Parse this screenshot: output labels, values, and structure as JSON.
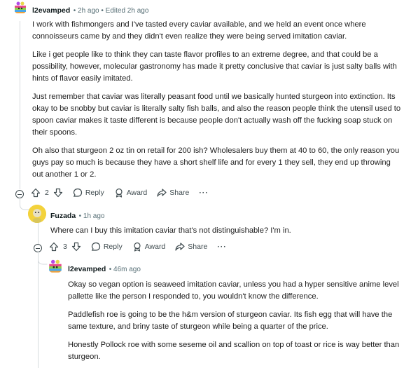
{
  "comment1": {
    "username": "l2evamped",
    "meta": "• 2h ago • Edited 2h ago",
    "paragraphs": [
      "I work with fishmongers and I've tasted every caviar available, and we held an event once where connoisseurs came by and they didn't even realize they were being served imitation caviar.",
      "Like i get people like to think they can taste flavor profiles to an extreme degree, and that could be a possibility, however, molecular gastronomy has made it pretty conclusive that caviar is just salty balls with hints of flavor easily imitated.",
      "Just remember that caviar was literally peasant food until we basically hunted sturgeon into extinction. Its okay to be snobby but caviar is literally salty fish balls, and also the reason people think the utensil used to spoon caviar makes it taste different is because people don't actually wash off the fucking soap stuck on their spoons.",
      "Oh also that sturgeon 2 oz tin on retail for 200 ish? Wholesalers buy them at 40 to 60, the only reason you guys pay so much is because they have a short shelf life and for every 1 they sell, they end up throwing out another 1 or 2."
    ],
    "votes": "2",
    "reply_label": "Reply",
    "award_label": "Award",
    "share_label": "Share",
    "more_label": "···"
  },
  "comment2": {
    "username": "Fuzada",
    "meta": "• 1h ago",
    "paragraphs": [
      "Where can I buy this imitation caviar that's not distinguishable? I'm in."
    ],
    "votes": "3",
    "reply_label": "Reply",
    "award_label": "Award",
    "share_label": "Share",
    "more_label": "···"
  },
  "comment3": {
    "username": "l2evamped",
    "meta": "• 46m ago",
    "paragraphs": [
      "Okay so vegan option is seaweed imitation caviar, unless you had a hyper sensitive anime level pallette like the person I responded to, you wouldn't know the difference.",
      "Paddlefish roe is going to be the h&m version of sturgeon caviar. Its fish egg that will have the same texture, and briny taste of sturgeon while being a quarter of the price.",
      "Honestly Pollock roe with some seseme oil and scallion on top of toast or rice is way better than sturgeon."
    ]
  },
  "colors": {
    "text": "#1c1c1c",
    "meta": "#576f76",
    "threadline": "#d6dbde",
    "icon": "#3e4a4e"
  }
}
